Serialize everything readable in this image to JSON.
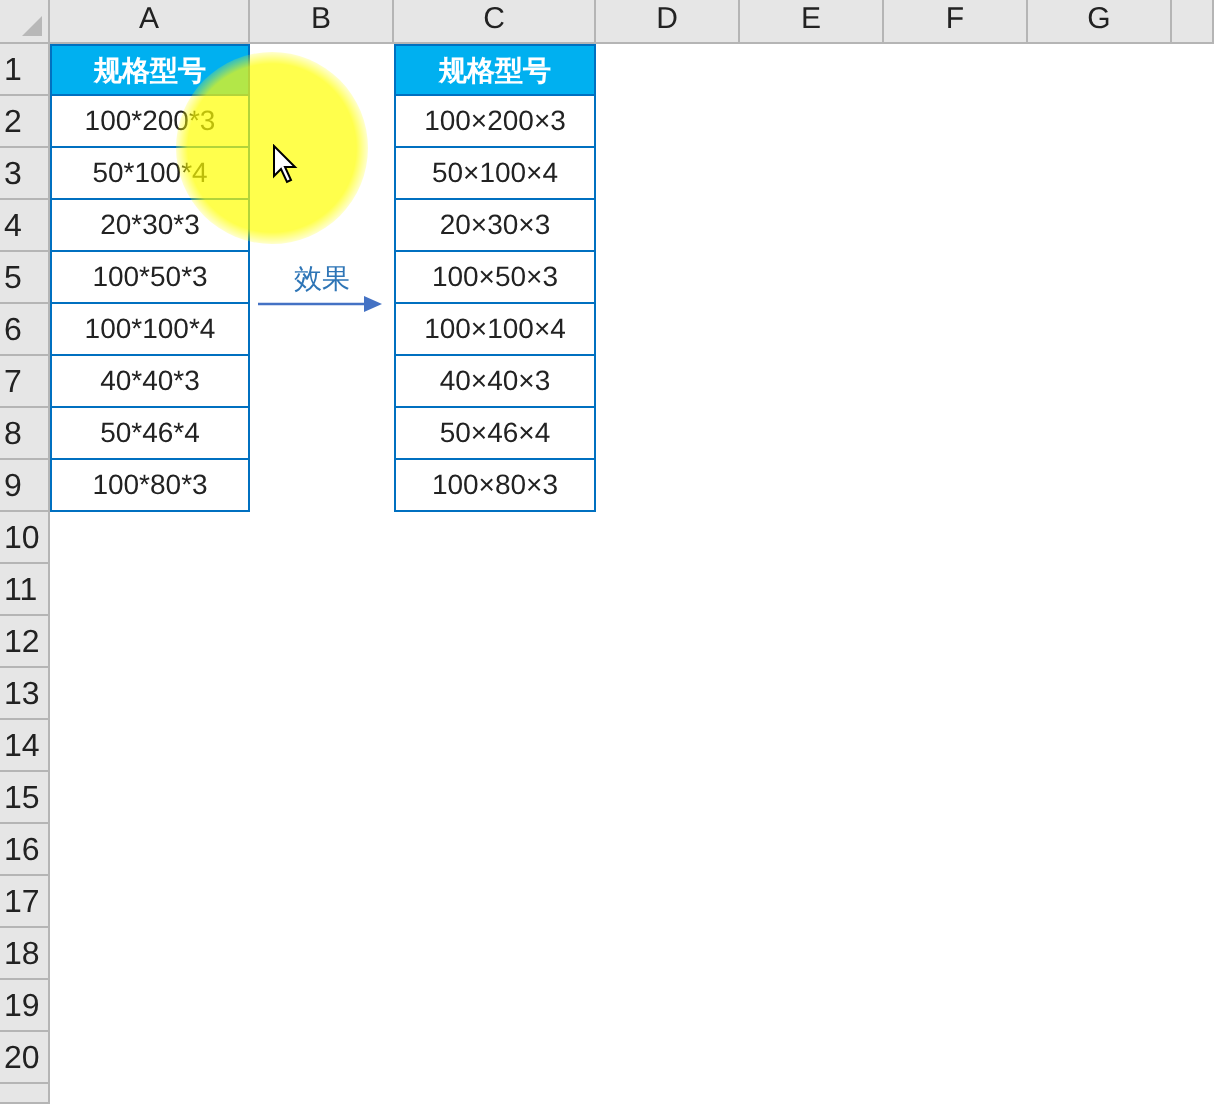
{
  "columns": [
    "A",
    "B",
    "C",
    "D",
    "E",
    "F",
    "G"
  ],
  "rows": [
    "1",
    "2",
    "3",
    "4",
    "5",
    "6",
    "7",
    "8",
    "9",
    "10",
    "11",
    "12",
    "13",
    "14",
    "15",
    "16",
    "17",
    "18",
    "19",
    "20"
  ],
  "tables": [
    {
      "header": "规格型号",
      "values": [
        "100*200*3",
        "50*100*4",
        "20*30*3",
        "100*50*3",
        "100*100*4",
        "40*40*3",
        "50*46*4",
        "100*80*3"
      ]
    },
    {
      "header": "规格型号",
      "values": [
        "100×200×3",
        "50×100×4",
        "20×30×3",
        "100×50×3",
        "100×100×4",
        "40×40×3",
        "50×46×4",
        "100×80×3"
      ]
    }
  ],
  "annotation": {
    "label": "效果"
  }
}
